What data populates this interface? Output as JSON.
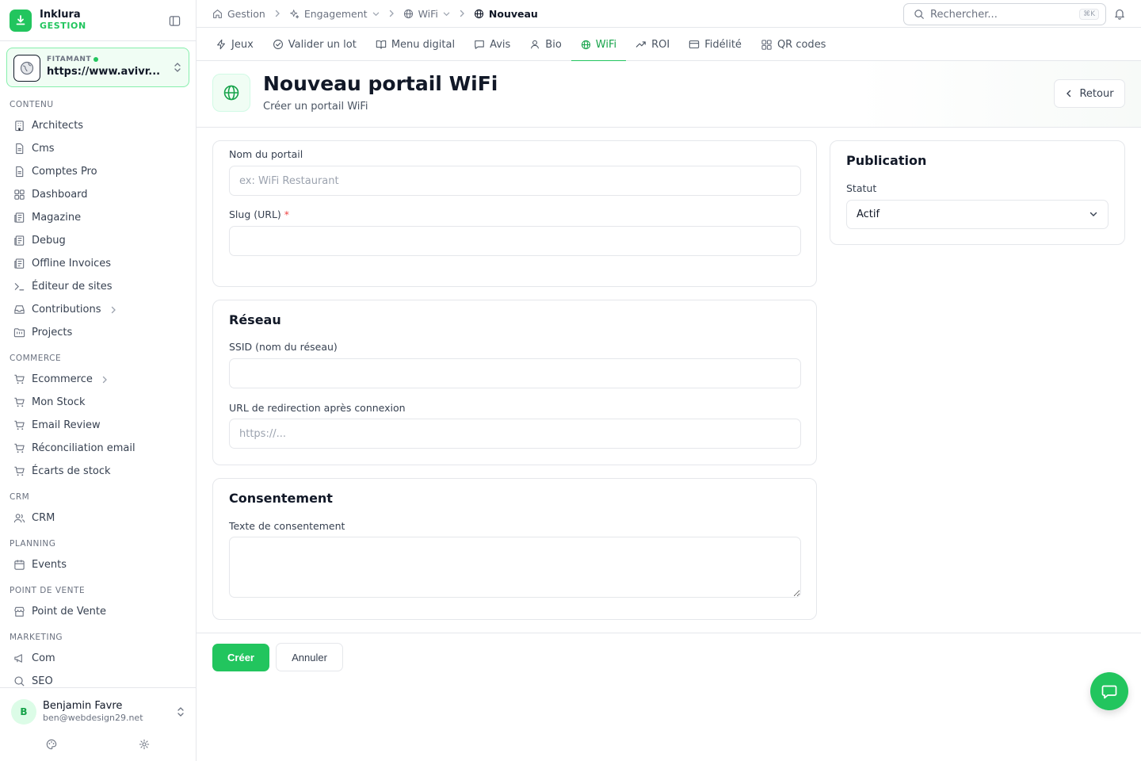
{
  "brand": {
    "name": "Inklura",
    "subtitle": "GESTION"
  },
  "site": {
    "label": "FITAMANT",
    "url": "https://www.avivr..."
  },
  "sidebar": {
    "sections": [
      {
        "title": "CONTENU",
        "items": [
          {
            "label": "Architects",
            "icon": "building-icon"
          },
          {
            "label": "Cms",
            "icon": "file-icon"
          },
          {
            "label": "Comptes Pro",
            "icon": "file-icon"
          },
          {
            "label": "Dashboard",
            "icon": "grid-icon"
          },
          {
            "label": "Magazine",
            "icon": "newspaper-icon"
          },
          {
            "label": "Debug",
            "icon": "newspaper-icon"
          },
          {
            "label": "Offline Invoices",
            "icon": "newspaper-icon"
          },
          {
            "label": "Éditeur de sites",
            "icon": "terminal-icon"
          },
          {
            "label": "Contributions",
            "icon": "inbox-icon",
            "chevron": true
          },
          {
            "label": "Projects",
            "icon": "folder-icon"
          }
        ]
      },
      {
        "title": "COMMERCE",
        "items": [
          {
            "label": "Ecommerce",
            "icon": "cart-icon",
            "chevron": true
          },
          {
            "label": "Mon Stock",
            "icon": "cart-icon"
          },
          {
            "label": "Email Review",
            "icon": "cart-icon"
          },
          {
            "label": "Réconciliation email",
            "icon": "cart-icon"
          },
          {
            "label": "Écarts de stock",
            "icon": "cart-icon"
          }
        ]
      },
      {
        "title": "CRM",
        "items": [
          {
            "label": "CRM",
            "icon": "users-icon"
          }
        ]
      },
      {
        "title": "PLANNING",
        "items": [
          {
            "label": "Events",
            "icon": "calendar-icon"
          }
        ]
      },
      {
        "title": "POINT DE VENTE",
        "items": [
          {
            "label": "Point de Vente",
            "icon": "store-icon"
          }
        ]
      },
      {
        "title": "MARKETING",
        "items": [
          {
            "label": "Com",
            "icon": "megaphone-icon"
          },
          {
            "label": "SEO",
            "icon": "search-icon"
          }
        ]
      }
    ]
  },
  "user": {
    "initial": "B",
    "name": "Benjamin Favre",
    "email": "ben@webdesign29.net"
  },
  "breadcrumb": {
    "items": [
      {
        "label": "Gestion",
        "icon": "home-icon",
        "dropdown": false
      },
      {
        "label": "Engagement",
        "icon": "sparkles-icon",
        "dropdown": true
      },
      {
        "label": "WiFi",
        "icon": "globe-icon",
        "dropdown": true
      },
      {
        "label": "Nouveau",
        "icon": "globe-icon",
        "dropdown": false,
        "current": true
      }
    ]
  },
  "search": {
    "placeholder": "Rechercher...",
    "shortcut": "⌘K"
  },
  "tabs": [
    {
      "label": "Jeux",
      "icon": "zap-icon"
    },
    {
      "label": "Valider un lot",
      "icon": "check-circle-icon"
    },
    {
      "label": "Menu digital",
      "icon": "book-icon"
    },
    {
      "label": "Avis",
      "icon": "message-icon"
    },
    {
      "label": "Bio",
      "icon": "user-icon"
    },
    {
      "label": "WiFi",
      "icon": "globe-icon",
      "active": true
    },
    {
      "label": "ROI",
      "icon": "trending-icon"
    },
    {
      "label": "Fidélité",
      "icon": "card-icon"
    },
    {
      "label": "QR codes",
      "icon": "grid-icon"
    }
  ],
  "page": {
    "title": "Nouveau portail WiFi",
    "subtitle": "Créer un portail WiFi",
    "back_label": "Retour"
  },
  "form": {
    "portal_name": {
      "label": "Nom du portail",
      "placeholder": "ex: WiFi Restaurant",
      "value": ""
    },
    "slug": {
      "label": "Slug (URL)",
      "required_mark": "*",
      "value": ""
    },
    "network": {
      "title": "Réseau",
      "ssid": {
        "label": "SSID (nom du réseau)",
        "value": ""
      },
      "redirect": {
        "label": "URL de redirection après connexion",
        "placeholder": "https://..."
      }
    },
    "consent": {
      "title": "Consentement",
      "text_label": "Texte de consentement"
    }
  },
  "publication": {
    "title": "Publication",
    "status_label": "Statut",
    "status_value": "Actif"
  },
  "actions": {
    "create_label": "Créer",
    "cancel_label": "Annuler"
  },
  "colors": {
    "accent": "#22c55e",
    "accent_dark": "#16a34a",
    "border": "#e5e7eb"
  }
}
